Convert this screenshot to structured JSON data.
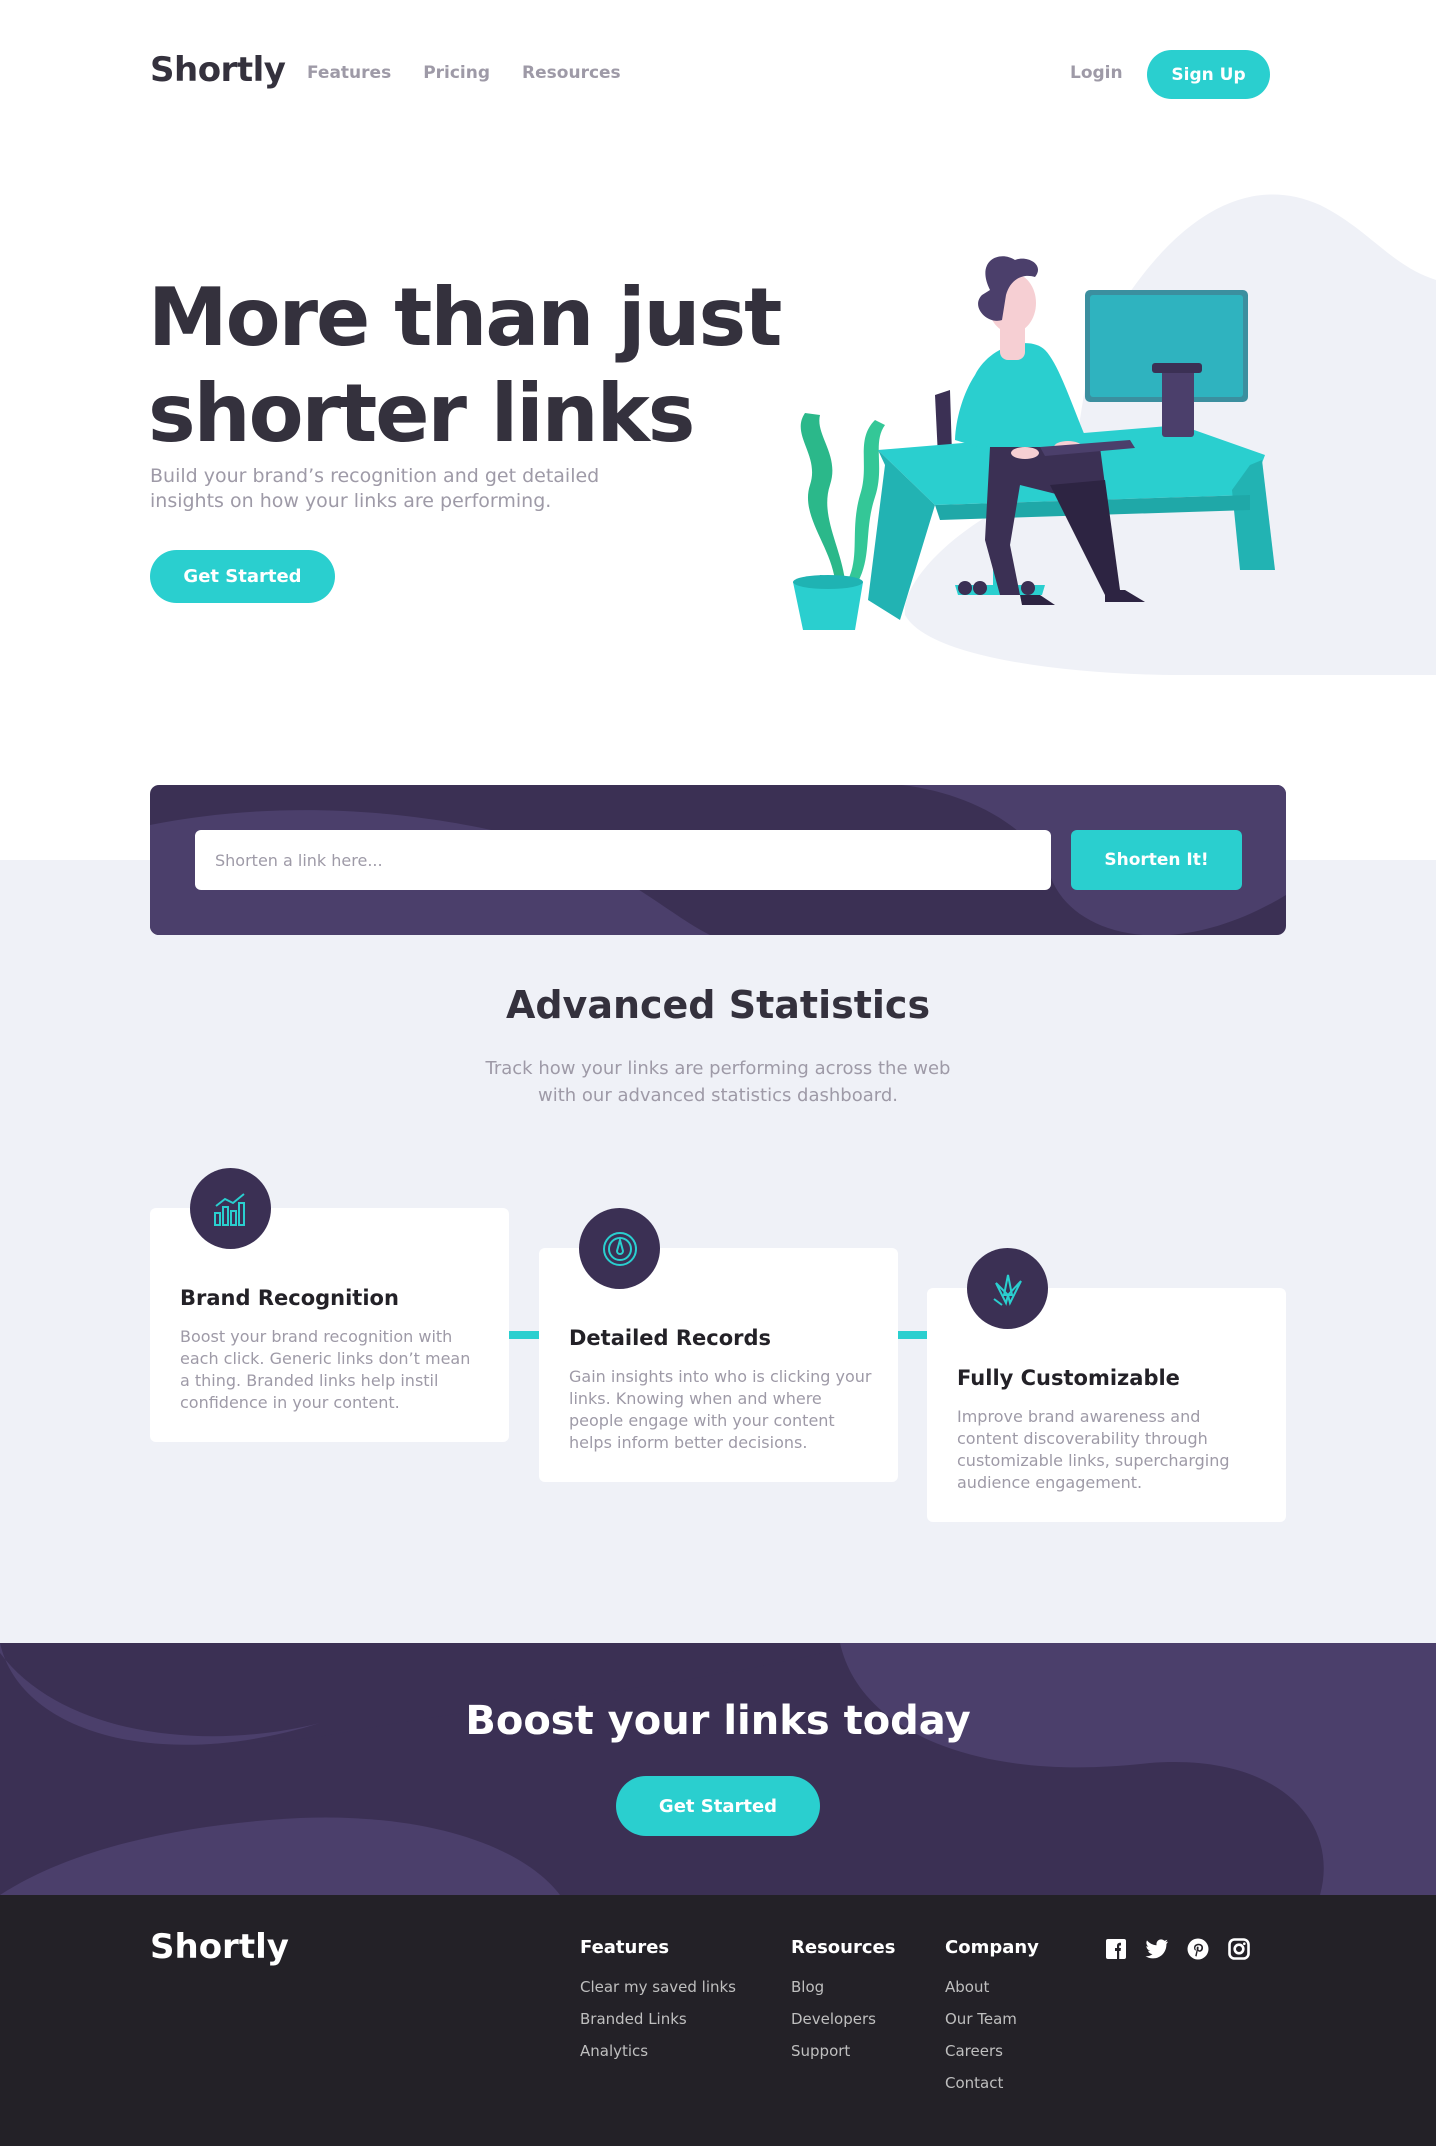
{
  "header": {
    "logo": "Shortly",
    "nav": [
      "Features",
      "Pricing",
      "Resources"
    ],
    "login": "Login",
    "signup": "Sign Up"
  },
  "hero": {
    "title": "More than just shorter links",
    "subtitle": "Build your brand’s recognition and get detailed insights on how your links are performing.",
    "cta": "Get Started"
  },
  "shorten": {
    "placeholder": "Shorten a link here...",
    "button": "Shorten It!"
  },
  "stats": {
    "title": "Advanced Statistics",
    "subtitle": "Track how your links are performing across the web with our advanced statistics dashboard.",
    "cards": [
      {
        "title": "Brand Recognition",
        "text": "Boost your brand recognition with each click. Generic links don’t mean a thing. Branded links help instil confidence in your content.",
        "icon": "bar-chart-icon"
      },
      {
        "title": "Detailed Records",
        "text": "Gain insights into who is clicking your links. Knowing when and where people engage with your content helps inform better decisions.",
        "icon": "gauge-icon"
      },
      {
        "title": "Fully Customizable",
        "text": "Improve brand awareness and content discoverability through customizable links, supercharging audience engagement.",
        "icon": "brushes-icon"
      }
    ]
  },
  "boost": {
    "title": "Boost your links today",
    "cta": "Get Started"
  },
  "footer": {
    "logo": "Shortly",
    "columns": [
      {
        "title": "Features",
        "links": [
          "Clear my saved links",
          "Branded Links",
          "Analytics"
        ]
      },
      {
        "title": "Resources",
        "links": [
          "Blog",
          "Developers",
          "Support"
        ]
      },
      {
        "title": "Company",
        "links": [
          "About",
          "Our Team",
          "Careers",
          "Contact"
        ]
      }
    ],
    "socials": [
      "facebook-icon",
      "twitter-icon",
      "pinterest-icon",
      "instagram-icon"
    ]
  },
  "colors": {
    "cyan": "#2acfcf",
    "dark_violet": "#3b3054",
    "grey_bg": "#eff1f7",
    "footer_bg": "#232127"
  }
}
